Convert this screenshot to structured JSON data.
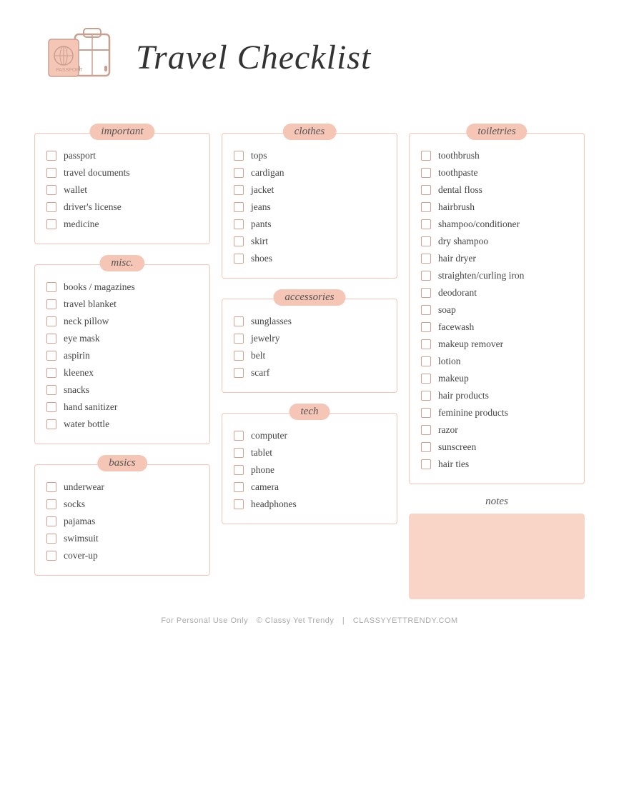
{
  "header": {
    "title": "Travel Checklist"
  },
  "footer": {
    "personal_use": "For Personal Use Only",
    "copyright": "© Classy Yet Trendy",
    "separator": "|",
    "website": "CLASSYYETTRENDY.COM"
  },
  "sections": {
    "important": {
      "title": "important",
      "items": [
        "passport",
        "travel documents",
        "wallet",
        "driver's license",
        "medicine"
      ]
    },
    "misc": {
      "title": "misc.",
      "items": [
        "books / magazines",
        "travel blanket",
        "neck pillow",
        "eye mask",
        "aspirin",
        "kleenex",
        "snacks",
        "hand sanitizer",
        "water bottle"
      ]
    },
    "basics": {
      "title": "basics",
      "items": [
        "underwear",
        "socks",
        "pajamas",
        "swimsuit",
        "cover-up"
      ]
    },
    "clothes": {
      "title": "clothes",
      "items": [
        "tops",
        "cardigan",
        "jacket",
        "jeans",
        "pants",
        "skirt",
        "shoes"
      ]
    },
    "accessories": {
      "title": "accessories",
      "items": [
        "sunglasses",
        "jewelry",
        "belt",
        "scarf"
      ]
    },
    "tech": {
      "title": "tech",
      "items": [
        "computer",
        "tablet",
        "phone",
        "camera",
        "headphones"
      ]
    },
    "toiletries": {
      "title": "toiletries",
      "items": [
        "toothbrush",
        "toothpaste",
        "dental floss",
        "hairbrush",
        "shampoo/conditioner",
        "dry shampoo",
        "hair dryer",
        "straighten/curling iron",
        "deodorant",
        "soap",
        "facewash",
        "makeup remover",
        "lotion",
        "makeup",
        "hair products",
        "feminine products",
        "razor",
        "sunscreen",
        "hair ties"
      ]
    },
    "notes": {
      "title": "notes"
    }
  }
}
